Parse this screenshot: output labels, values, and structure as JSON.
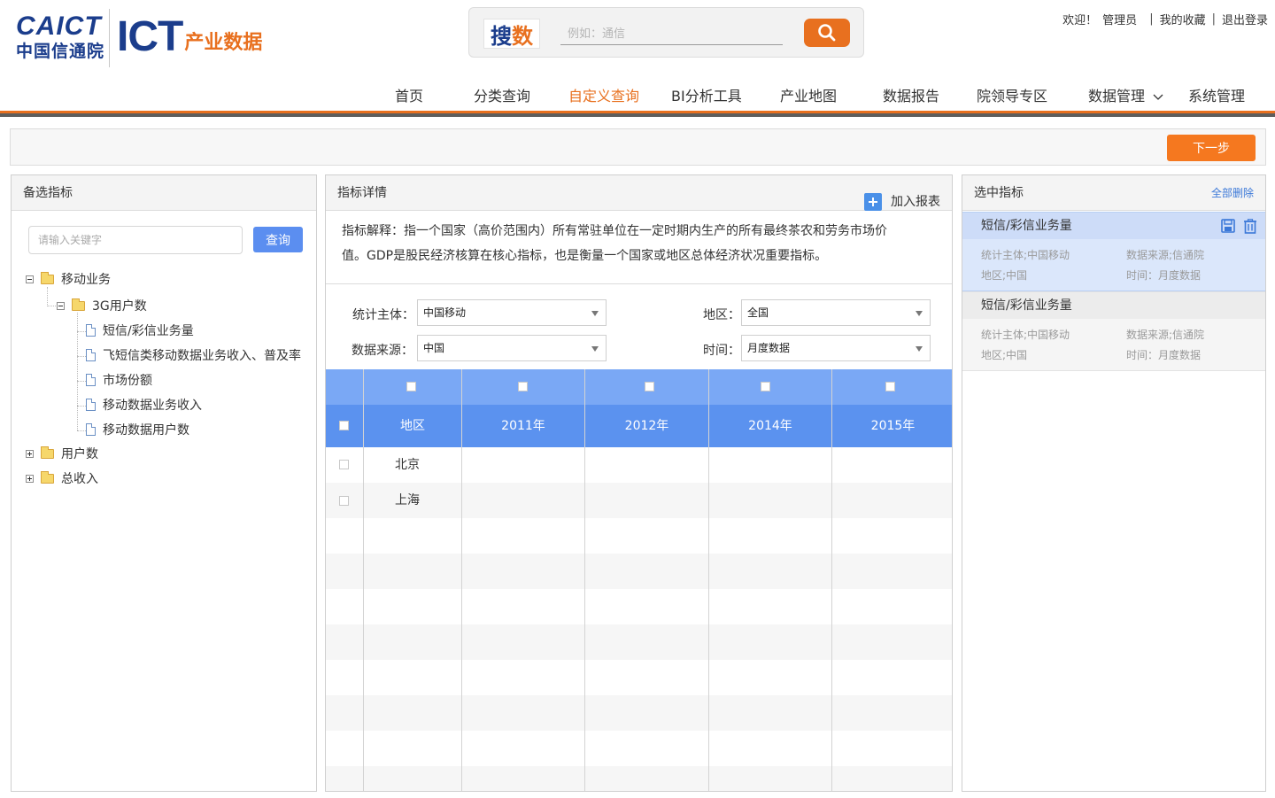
{
  "logo": {
    "caict_en": "CAICT",
    "caict_cn": "中国信通院",
    "ict": "ICT",
    "ict_cn": "产业数据"
  },
  "search": {
    "logo_part1": "搜",
    "logo_part2": "数",
    "placeholder": "例如：通信"
  },
  "top_links": {
    "welcome": "欢迎！",
    "user": "管理员",
    "sep": "|",
    "favorites": "我的收藏",
    "logout": "退出登录"
  },
  "nav": {
    "items": [
      "首页",
      "分类查询",
      "自定义查询",
      "BI分析工具",
      "产业地图",
      "数据报告",
      "院领导专区",
      "数据管理",
      "系统管理"
    ],
    "active_index": 2
  },
  "step": {
    "next_label": "下一步"
  },
  "left": {
    "title": "备选指标",
    "keyword_placeholder": "请输入关键字",
    "query_label": "查询",
    "tree": {
      "n1": "移动业务",
      "n1_1": "3G用户数",
      "leaf1": "短信/彩信业务量",
      "leaf2": "飞短信类移动数据业务收入、普及率",
      "leaf3": "市场份额",
      "leaf4": "移动数据业务收入",
      "leaf5": "移动数据用户数",
      "n2": "用户数",
      "n3": "总收入"
    }
  },
  "middle": {
    "title": "指标详情",
    "add_report": "加入报表",
    "desc_line1": "指标解释：指一个国家（高价范围内）所有常驻单位在一定时期内生产的所有最终茶农和劳务市场价",
    "desc_line2": "值。GDP是股民经济核算在核心指标，也是衡量一个国家或地区总体经济状况重要指标。",
    "filters": {
      "subject_label": "统计主体：",
      "subject_value": "中国移动",
      "region_label": "地区：",
      "region_value": "全国",
      "source_label": "数据来源：",
      "source_value": "中国",
      "time_label": "时间：",
      "time_value": "月度数据"
    },
    "table": {
      "headers": [
        "地区",
        "2011年",
        "2012年",
        "2014年",
        "2015年"
      ],
      "rows": [
        [
          "北京",
          "",
          "",
          "",
          ""
        ],
        [
          "上海",
          "",
          "",
          "",
          ""
        ]
      ]
    }
  },
  "right": {
    "title": "选中指标",
    "delete_all": "全部删除",
    "cards": [
      {
        "title": "短信/彩信业务量",
        "subject": "统计主体;中国移动",
        "source": "数据来源;信通院",
        "region": "地区;中国",
        "time": "时间：月度数据"
      },
      {
        "title": "短信/彩信业务量",
        "subject": "统计主体;中国移动",
        "source": "数据来源;信通院",
        "region": "地区;中国",
        "time": "时间：月度数据"
      }
    ]
  },
  "colors": {
    "accent_orange": "#e8701f",
    "brand_blue": "#1b3d8c",
    "table_header_blue": "#5b92ef",
    "button_blue": "#5b8ef0"
  }
}
